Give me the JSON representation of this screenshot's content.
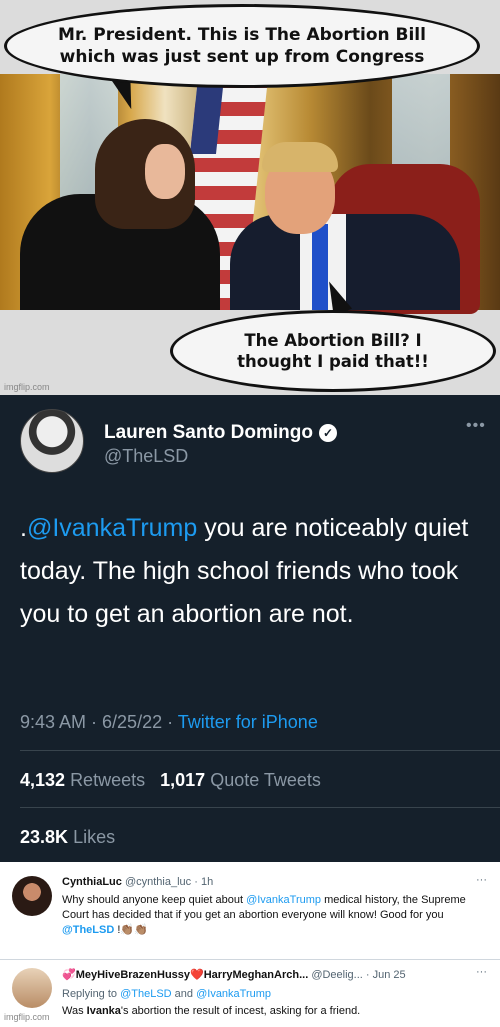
{
  "meme": {
    "bubble_top": "Mr. President.  This is The Abortion Bill which was just sent up from Congress",
    "bubble_bottom": "The Abortion Bill? I thought I paid that!!",
    "watermark": "imgflip.com"
  },
  "tweet": {
    "display_name": "Lauren Santo Domingo",
    "handle": "@TheLSD",
    "more_icon": "more-icon",
    "verified_icon": "verified-badge-icon",
    "body_prefix": ".",
    "body_mention": "@IvankaTrump",
    "body_text": " you are noticeably quiet today. The high school friends who took you to get an abortion are not.",
    "time": "9:43 AM · 6/25/22 · ",
    "source": "Twitter for iPhone",
    "retweets_count": "4,132",
    "retweets_label": "Retweets",
    "quotes_count": "1,017",
    "quotes_label": "Quote Tweets",
    "likes_count": "23.8K",
    "likes_label": "Likes",
    "colors": {
      "background": "#15202b",
      "link": "#1d9bf0",
      "secondary": "#8b98a5"
    }
  },
  "replies": [
    {
      "name": "CynthiaLuc",
      "handle": "@cynthia_luc",
      "time": "1h",
      "text_1": "Why should anyone keep quiet about ",
      "mention_1": "@IvankaTrump",
      "text_2": " medical history, the Supreme Court has decided that if you  get an abortion everyone will know! Good for you ",
      "mention_2": "@TheLSD",
      "text_3": " !👏🏽👏🏽"
    },
    {
      "name": "💞MeyHiveBrazenHussy❤️HarryMeghanArch...",
      "handle": "@Deelig...",
      "time": "Jun 25",
      "replying_prefix": "Replying to ",
      "replying_1": "@TheLSD",
      "replying_and": " and ",
      "replying_2": "@IvankaTrump",
      "text_1": "Was ",
      "text_bold": "Ivanka",
      "text_2": "'s abortion the result of incest, asking for a friend."
    }
  ],
  "footer_watermark": "imgflip.com"
}
